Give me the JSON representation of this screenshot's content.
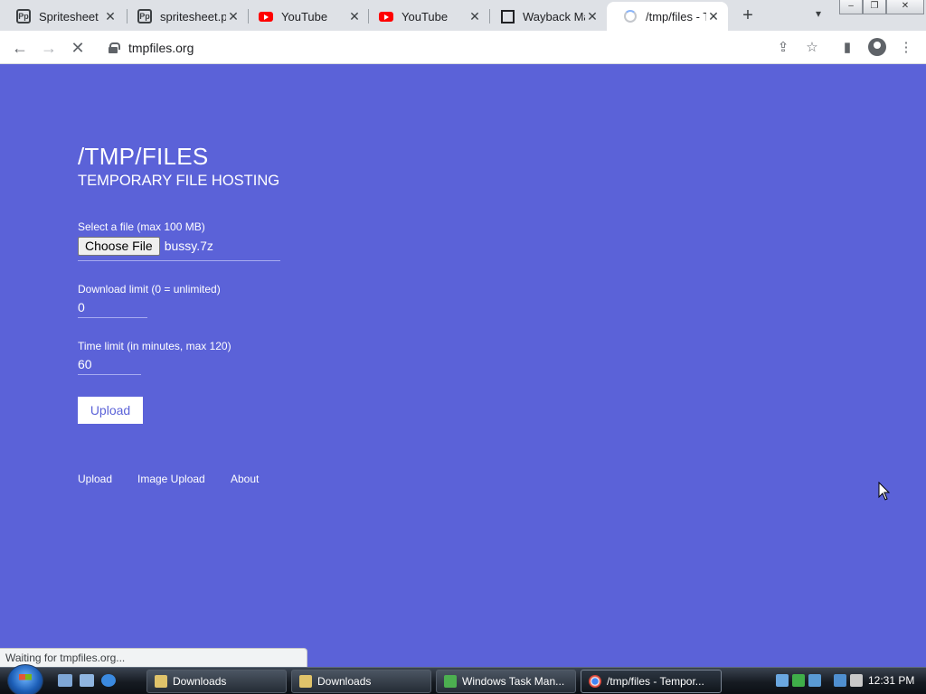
{
  "browser": {
    "tabs": [
      {
        "title": "Spritesheet",
        "favicon": "photopea-icon"
      },
      {
        "title": "spritesheet.p",
        "favicon": "photopea-icon"
      },
      {
        "title": "YouTube",
        "favicon": "youtube-icon"
      },
      {
        "title": "YouTube",
        "favicon": "youtube-icon"
      },
      {
        "title": "Wayback Ma",
        "favicon": "wayback-icon"
      },
      {
        "title": "/tmp/files - T",
        "favicon": "loading-spinner-icon",
        "active": true
      }
    ],
    "url": "tmpfiles.org",
    "status_text": "Waiting for tmpfiles.org..."
  },
  "page": {
    "title": "/TMP/FILES",
    "subtitle": "TEMPORARY FILE HOSTING",
    "file_label": "Select a file (max 100 MB)",
    "choose_file_label": "Choose File",
    "selected_file": "bussy.7z",
    "download_limit_label": "Download limit (0 = unlimited)",
    "download_limit_value": "0",
    "time_limit_label": "Time limit (in minutes, max 120)",
    "time_limit_value": "60",
    "upload_button": "Upload",
    "footer_links": [
      "Upload",
      "Image Upload",
      "About"
    ],
    "background_color": "#5b62d8"
  },
  "taskbar": {
    "items": [
      {
        "label": "Downloads",
        "icon": "folder-icon"
      },
      {
        "label": "Downloads",
        "icon": "folder-icon"
      },
      {
        "label": "Windows Task Man...",
        "icon": "task-manager-icon"
      },
      {
        "label": "/tmp/files - Tempor...",
        "icon": "chrome-icon",
        "active": true
      }
    ],
    "clock": "12:31 PM"
  }
}
